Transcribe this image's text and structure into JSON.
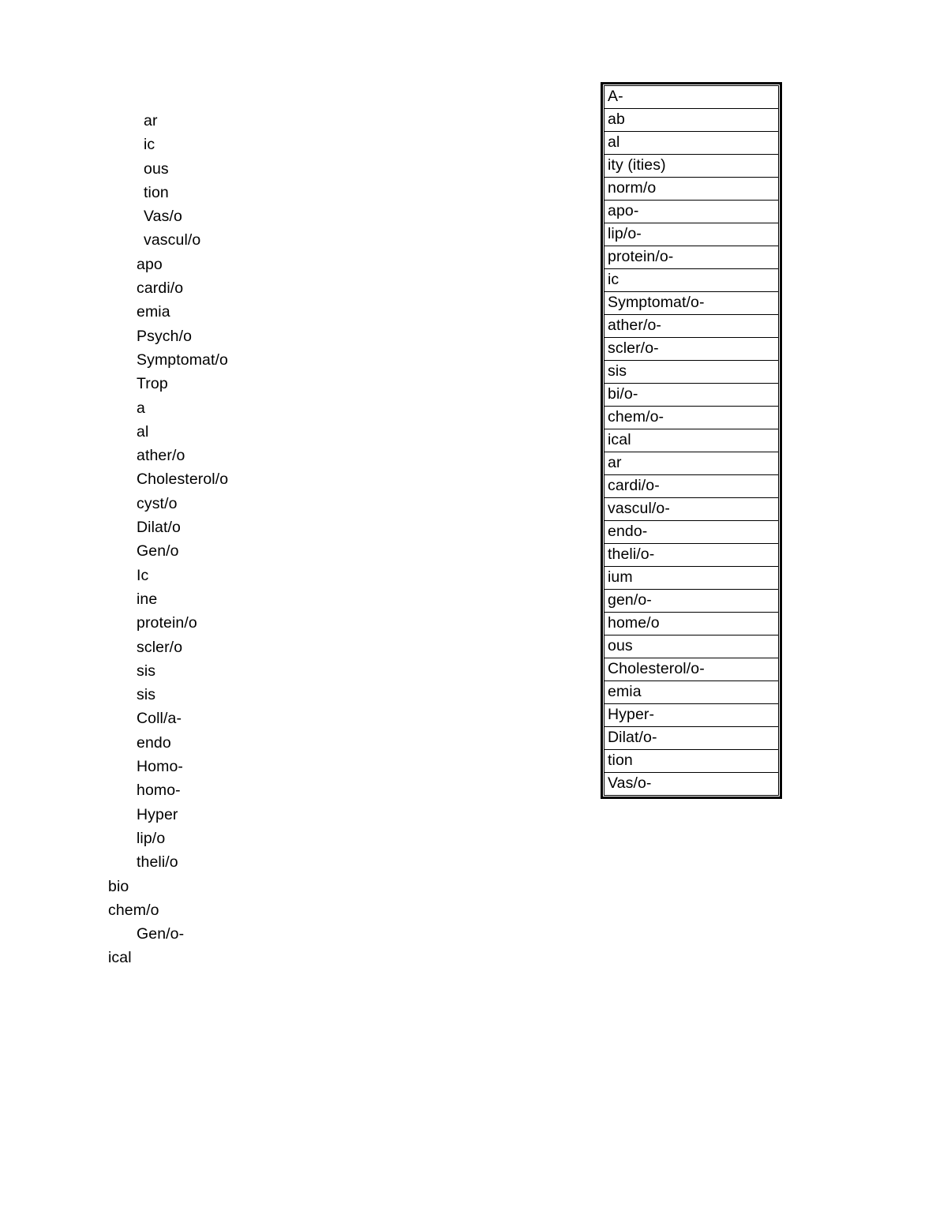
{
  "document": {
    "page_background": "#ffffff",
    "text_color": "#000000",
    "border_color": "#000000"
  },
  "left_column": {
    "name": "word-parts-list",
    "lines": [
      {
        "text": "ar",
        "indent": 2
      },
      {
        "text": "ic",
        "indent": 2
      },
      {
        "text": "ous",
        "indent": 2
      },
      {
        "text": "tion",
        "indent": 2
      },
      {
        "text": "Vas/o",
        "indent": 2
      },
      {
        "text": "vascul/o",
        "indent": 2
      },
      {
        "text": "apo",
        "indent": 1
      },
      {
        "text": "cardi/o",
        "indent": 1
      },
      {
        "text": "emia",
        "indent": 1
      },
      {
        "text": "Psych/o",
        "indent": 1
      },
      {
        "text": "Symptomat/o",
        "indent": 1
      },
      {
        "text": "Trop",
        "indent": 1
      },
      {
        "text": "a",
        "indent": 1
      },
      {
        "text": "al",
        "indent": 1
      },
      {
        "text": "ather/o",
        "indent": 1
      },
      {
        "text": "Cholesterol/o",
        "indent": 1
      },
      {
        "text": "cyst/o",
        "indent": 1
      },
      {
        "text": "Dilat/o",
        "indent": 1
      },
      {
        "text": "Gen/o",
        "indent": 1
      },
      {
        "text": "Ic",
        "indent": 1
      },
      {
        "text": "ine",
        "indent": 1
      },
      {
        "text": "protein/o",
        "indent": 1
      },
      {
        "text": "scler/o",
        "indent": 1
      },
      {
        "text": "sis",
        "indent": 1
      },
      {
        "text": "sis",
        "indent": 1
      },
      {
        "text": "Coll/a-",
        "indent": 1
      },
      {
        "text": "endo",
        "indent": 1
      },
      {
        "text": "Homo-",
        "indent": 1
      },
      {
        "text": "homo-",
        "indent": 1
      },
      {
        "text": "Hyper",
        "indent": 1
      },
      {
        "text": "lip/o",
        "indent": 1
      },
      {
        "text": "theli/o",
        "indent": 1
      },
      {
        "text": "bio",
        "indent": 0
      },
      {
        "text": "chem/o",
        "indent": 0
      },
      {
        "text": "Gen/o-",
        "indent": 1
      },
      {
        "text": "ical",
        "indent": 0
      }
    ]
  },
  "table": {
    "name": "word-part-table",
    "rows": [
      {
        "text": "A-"
      },
      {
        "text": "ab"
      },
      {
        "text": "al"
      },
      {
        "text": "ity (ities)"
      },
      {
        "text": "norm/o"
      },
      {
        "text": "apo-"
      },
      {
        "text": "lip/o-"
      },
      {
        "text": "protein/o-"
      },
      {
        "text": "ic"
      },
      {
        "text": "Symptomat/o-"
      },
      {
        "text": "ather/o-"
      },
      {
        "text": "scler/o-"
      },
      {
        "text": "sis"
      },
      {
        "text": "bi/o-"
      },
      {
        "text": "chem/o-"
      },
      {
        "text": "ical"
      },
      {
        "text": "ar"
      },
      {
        "text": "cardi/o-"
      },
      {
        "text": "vascul/o-"
      },
      {
        "text": "endo-"
      },
      {
        "text": "theli/o-"
      },
      {
        "text": "ium"
      },
      {
        "text": "gen/o-"
      },
      {
        "text": "home/o"
      },
      {
        "text": "ous"
      },
      {
        "text": "Cholesterol/o-"
      },
      {
        "text": "emia"
      },
      {
        "text": "Hyper-"
      },
      {
        "text": "Dilat/o-"
      },
      {
        "text": "tion"
      },
      {
        "text": "Vas/o-"
      }
    ]
  }
}
